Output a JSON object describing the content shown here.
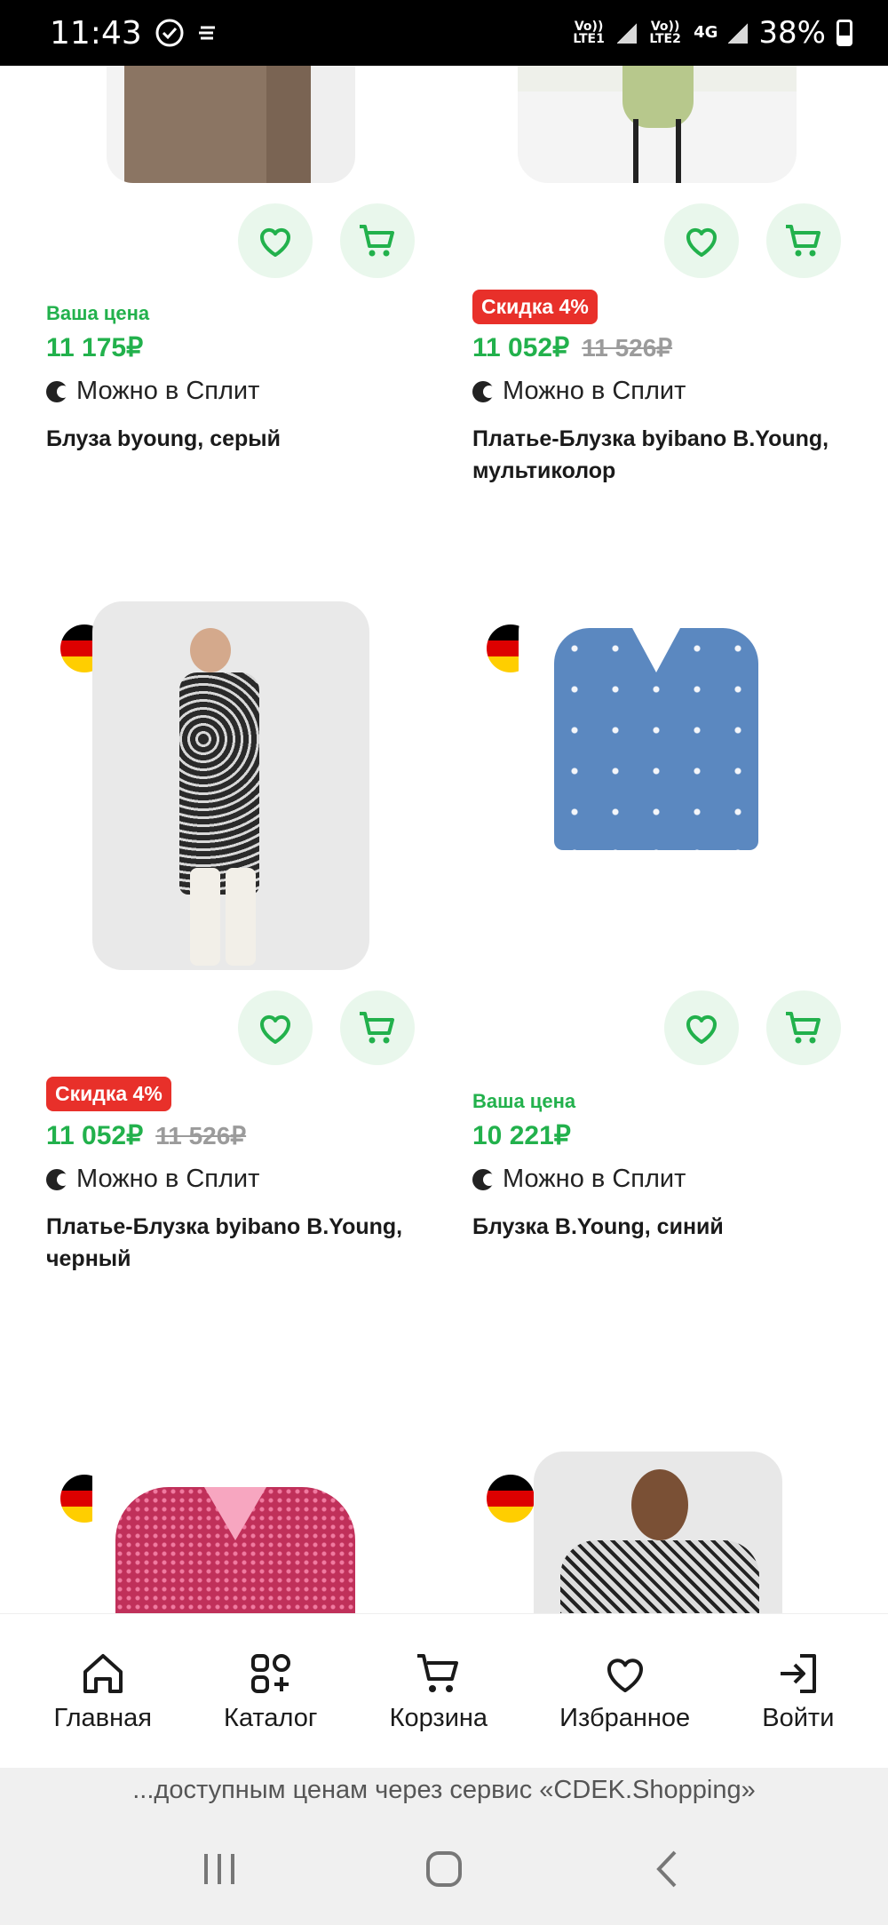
{
  "status": {
    "time": "11:43",
    "sim1": "Vo)) LTE1",
    "sim2": "Vo)) LTE2",
    "net": "4G",
    "battery": "38%"
  },
  "products": [
    {
      "tag_type": "your_price",
      "tag": "Ваша цена",
      "price": "11 175₽",
      "old_price": "",
      "split": "Можно в Сплит",
      "title": "Блуза byoung, серый",
      "flag": false
    },
    {
      "tag_type": "discount",
      "tag": "Скидка 4%",
      "price": "11 052₽",
      "old_price": "11 526₽",
      "split": "Можно в Сплит",
      "title": "Платье-Блузка byibano B.Young, мультиколор",
      "flag": false
    },
    {
      "tag_type": "discount",
      "tag": "Скидка 4%",
      "price": "11 052₽",
      "old_price": "11 526₽",
      "split": "Можно в Сплит",
      "title": "Платье-Блузка byibano B.Young, черный",
      "flag": true
    },
    {
      "tag_type": "your_price",
      "tag": "Ваша цена",
      "price": "10 221₽",
      "old_price": "",
      "split": "Можно в Сплит",
      "title": "Блузка B.Young, синий",
      "flag": true
    },
    {
      "flag": true
    },
    {
      "flag": true
    }
  ],
  "nav": {
    "items": [
      {
        "label": "Главная",
        "icon": "home-icon"
      },
      {
        "label": "Каталог",
        "icon": "catalog-icon"
      },
      {
        "label": "Корзина",
        "icon": "cart-icon"
      },
      {
        "label": "Избранное",
        "icon": "heart-icon"
      },
      {
        "label": "Войти",
        "icon": "login-icon"
      }
    ]
  },
  "banner": "...доступным ценам через сервис «CDEK.Shopping»",
  "colors": {
    "accent": "#22b14c",
    "discount": "#e8302a",
    "favorite_bg": "#e9f7ec"
  }
}
